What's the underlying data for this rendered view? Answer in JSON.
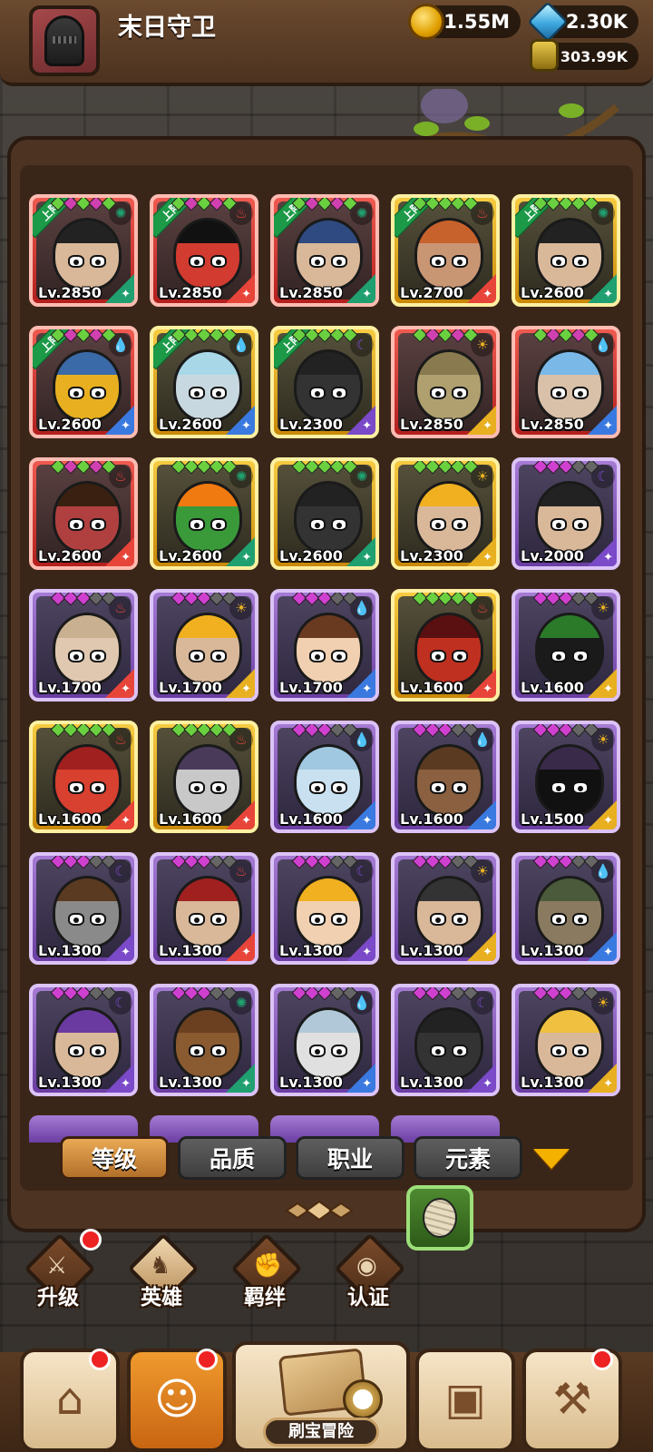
{
  "header": {
    "player_name": "末日守卫",
    "gold": "1.55M",
    "gems": "2.30K",
    "scrolls": "303.99K"
  },
  "heroes": [
    {
      "lv": "Lv.2850",
      "frame": "red",
      "deployed": true,
      "elem": "wind",
      "face": "#d9b89a",
      "hair": "#222"
    },
    {
      "lv": "Lv.2850",
      "frame": "red",
      "deployed": true,
      "elem": "fire",
      "face": "#d23b30",
      "hair": "#111"
    },
    {
      "lv": "Lv.2850",
      "frame": "red",
      "deployed": true,
      "elem": "wind",
      "face": "#d9b89a",
      "hair": "#2f4a80"
    },
    {
      "lv": "Lv.2700",
      "frame": "gold",
      "deployed": true,
      "elem": "fire",
      "face": "#c99674",
      "hair": "#c8622c"
    },
    {
      "lv": "Lv.2600",
      "frame": "gold",
      "deployed": true,
      "elem": "wind",
      "face": "#d9b89a",
      "hair": "#222"
    },
    {
      "lv": "Lv.2600",
      "frame": "red",
      "deployed": true,
      "elem": "water",
      "face": "#e8b020",
      "hair": "#3a6aa8"
    },
    {
      "lv": "Lv.2600",
      "frame": "gold",
      "deployed": true,
      "elem": "water",
      "face": "#c8d8e0",
      "hair": "#a8d8e8"
    },
    {
      "lv": "Lv.2300",
      "frame": "gold",
      "deployed": true,
      "elem": "dark",
      "face": "#333",
      "hair": "#222"
    },
    {
      "lv": "Lv.2850",
      "frame": "red",
      "deployed": false,
      "elem": "light",
      "face": "#b0a070",
      "hair": "#8a7a50"
    },
    {
      "lv": "Lv.2850",
      "frame": "red",
      "deployed": false,
      "elem": "water",
      "face": "#d9c0a8",
      "hair": "#7ab8e8"
    },
    {
      "lv": "Lv.2600",
      "frame": "red",
      "deployed": false,
      "elem": "fire",
      "face": "#b04040",
      "hair": "#3a2010"
    },
    {
      "lv": "Lv.2600",
      "frame": "gold",
      "deployed": false,
      "elem": "wind",
      "face": "#3a9a3a",
      "hair": "#f07a10"
    },
    {
      "lv": "Lv.2600",
      "frame": "gold",
      "deployed": false,
      "elem": "wind",
      "face": "#333",
      "hair": "#222"
    },
    {
      "lv": "Lv.2300",
      "frame": "gold",
      "deployed": false,
      "elem": "light",
      "face": "#d9b89a",
      "hair": "#f0b020"
    },
    {
      "lv": "Lv.2000",
      "frame": "purple",
      "deployed": false,
      "elem": "dark",
      "face": "#d9b89a",
      "hair": "#222"
    },
    {
      "lv": "Lv.1700",
      "frame": "purple",
      "deployed": false,
      "elem": "fire",
      "face": "#e0c8b0",
      "hair": "#c9b090"
    },
    {
      "lv": "Lv.1700",
      "frame": "purple",
      "deployed": false,
      "elem": "light",
      "face": "#d9b89a",
      "hair": "#f0b020"
    },
    {
      "lv": "Lv.1700",
      "frame": "purple",
      "deployed": false,
      "elem": "water",
      "face": "#f0d0b0",
      "hair": "#6a3a20"
    },
    {
      "lv": "Lv.1600",
      "frame": "gold",
      "deployed": false,
      "elem": "fire",
      "face": "#c03020",
      "hair": "#5a1010"
    },
    {
      "lv": "Lv.1600",
      "frame": "purple",
      "deployed": false,
      "elem": "light",
      "face": "#1a1a1a",
      "hair": "#2a7a2a"
    },
    {
      "lv": "Lv.1600",
      "frame": "gold",
      "deployed": false,
      "elem": "fire",
      "face": "#d84030",
      "hair": "#a02020"
    },
    {
      "lv": "Lv.1600",
      "frame": "gold",
      "deployed": false,
      "elem": "fire",
      "face": "#c8c8c8",
      "hair": "#4a3a5a"
    },
    {
      "lv": "Lv.1600",
      "frame": "purple",
      "deployed": false,
      "elem": "water",
      "face": "#c8e0f0",
      "hair": "#a0c8e0"
    },
    {
      "lv": "Lv.1600",
      "frame": "purple",
      "deployed": false,
      "elem": "water",
      "face": "#8a6040",
      "hair": "#5a3a20"
    },
    {
      "lv": "Lv.1500",
      "frame": "purple",
      "deployed": false,
      "elem": "light",
      "face": "#111",
      "hair": "#3a2a4a"
    },
    {
      "lv": "Lv.1300",
      "frame": "purple",
      "deployed": false,
      "elem": "dark",
      "face": "#8a8a8a",
      "hair": "#5a3a20"
    },
    {
      "lv": "Lv.1300",
      "frame": "purple",
      "deployed": false,
      "elem": "fire",
      "face": "#d9b89a",
      "hair": "#a02020"
    },
    {
      "lv": "Lv.1300",
      "frame": "purple",
      "deployed": false,
      "elem": "dark",
      "face": "#f0d0b0",
      "hair": "#f0b020"
    },
    {
      "lv": "Lv.1300",
      "frame": "purple",
      "deployed": false,
      "elem": "light",
      "face": "#d9b89a",
      "hair": "#333"
    },
    {
      "lv": "Lv.1300",
      "frame": "purple",
      "deployed": false,
      "elem": "water",
      "face": "#8a7a60",
      "hair": "#4a5a3a"
    },
    {
      "lv": "Lv.1300",
      "frame": "purple",
      "deployed": false,
      "elem": "dark",
      "face": "#d9b89a",
      "hair": "#6a3aa0"
    },
    {
      "lv": "Lv.1300",
      "frame": "purple",
      "deployed": false,
      "elem": "wind",
      "face": "#8a5a30",
      "hair": "#6a4020"
    },
    {
      "lv": "Lv.1300",
      "frame": "purple",
      "deployed": false,
      "elem": "water",
      "face": "#e0e0e0",
      "hair": "#b0c8d8"
    },
    {
      "lv": "Lv.1300",
      "frame": "purple",
      "deployed": false,
      "elem": "dark",
      "face": "#333",
      "hair": "#222"
    },
    {
      "lv": "Lv.1300",
      "frame": "purple",
      "deployed": false,
      "elem": "light",
      "face": "#d9b89a",
      "hair": "#f0c040"
    }
  ],
  "deployed_badge": "上阵",
  "filters": [
    {
      "label": "等级",
      "active": true
    },
    {
      "label": "品质",
      "active": false
    },
    {
      "label": "职业",
      "active": false
    },
    {
      "label": "元素",
      "active": false
    }
  ],
  "subnav": [
    {
      "label": "升级",
      "icon": "sword-icon",
      "notify": true
    },
    {
      "label": "英雄",
      "icon": "hero-icon",
      "active": true
    },
    {
      "label": "羁绊",
      "icon": "fist-icon"
    },
    {
      "label": "认证",
      "icon": "eye-icon"
    }
  ],
  "bottomnav": {
    "adventure_label": "刷宝冒险"
  }
}
